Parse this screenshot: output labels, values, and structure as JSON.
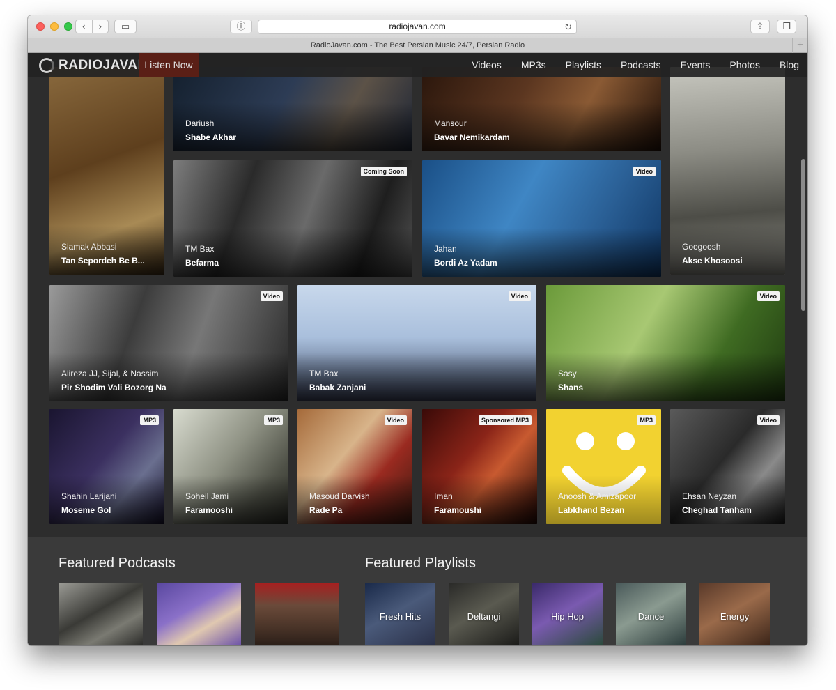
{
  "browser": {
    "url": "radiojavan.com",
    "tab_title": "RadioJavan.com - The Best Persian Music 24/7, Persian Radio",
    "back_glyph": "‹",
    "forward_glyph": "›",
    "reload_glyph": "↻",
    "share_glyph": "⇪",
    "tabs_glyph": "❐",
    "new_tab_glyph": "+",
    "info_glyph": "ⓘ",
    "sidebar_glyph": "▭"
  },
  "site": {
    "logo": "RADIOJAVAN",
    "listen_now": "Listen Now",
    "nav": [
      "Videos",
      "MP3s",
      "Playlists",
      "Podcasts",
      "Events",
      "Photos",
      "Blog"
    ]
  },
  "tiles": [
    {
      "artist": "Siamak Abbasi",
      "song": "Tan Sepordeh Be B...",
      "badge": ""
    },
    {
      "artist": "Dariush",
      "song": "Shabe Akhar",
      "badge": ""
    },
    {
      "artist": "Mansour",
      "song": "Bavar Nemikardam",
      "badge": ""
    },
    {
      "artist": "Googoosh",
      "song": "Akse Khosoosi",
      "badge": ""
    },
    {
      "artist": "TM Bax",
      "song": "Befarma",
      "badge": "Coming Soon"
    },
    {
      "artist": "Jahan",
      "song": "Bordi Az Yadam",
      "badge": "Video"
    },
    {
      "artist": "Alireza JJ, Sijal, & Nassim",
      "song": "Pir Shodim Vali Bozorg Na",
      "badge": "Video"
    },
    {
      "artist": "TM Bax",
      "song": "Babak Zanjani",
      "badge": "Video"
    },
    {
      "artist": "Sasy",
      "song": "Shans",
      "badge": "Video"
    },
    {
      "artist": "Shahin Larijani",
      "song": "Moseme Gol",
      "badge": "MP3"
    },
    {
      "artist": "Soheil Jami",
      "song": "Faramooshi",
      "badge": "MP3"
    },
    {
      "artist": "Masoud Darvish",
      "song": "Rade Pa",
      "badge": "Video"
    },
    {
      "artist": "Iman",
      "song": "Faramoushi",
      "badge": "Sponsored MP3"
    },
    {
      "artist": "Anoosh & Amizapoor",
      "song": "Labkhand Bezan",
      "badge": "MP3"
    },
    {
      "artist": "Ehsan Neyzan",
      "song": "Cheghad Tanham",
      "badge": "Video"
    }
  ],
  "featured": {
    "podcasts_title": "Featured Podcasts",
    "playlists_title": "Featured Playlists",
    "playlists": [
      "Fresh Hits",
      "Deltangi",
      "Hip Hop",
      "Dance",
      "Energy"
    ]
  }
}
